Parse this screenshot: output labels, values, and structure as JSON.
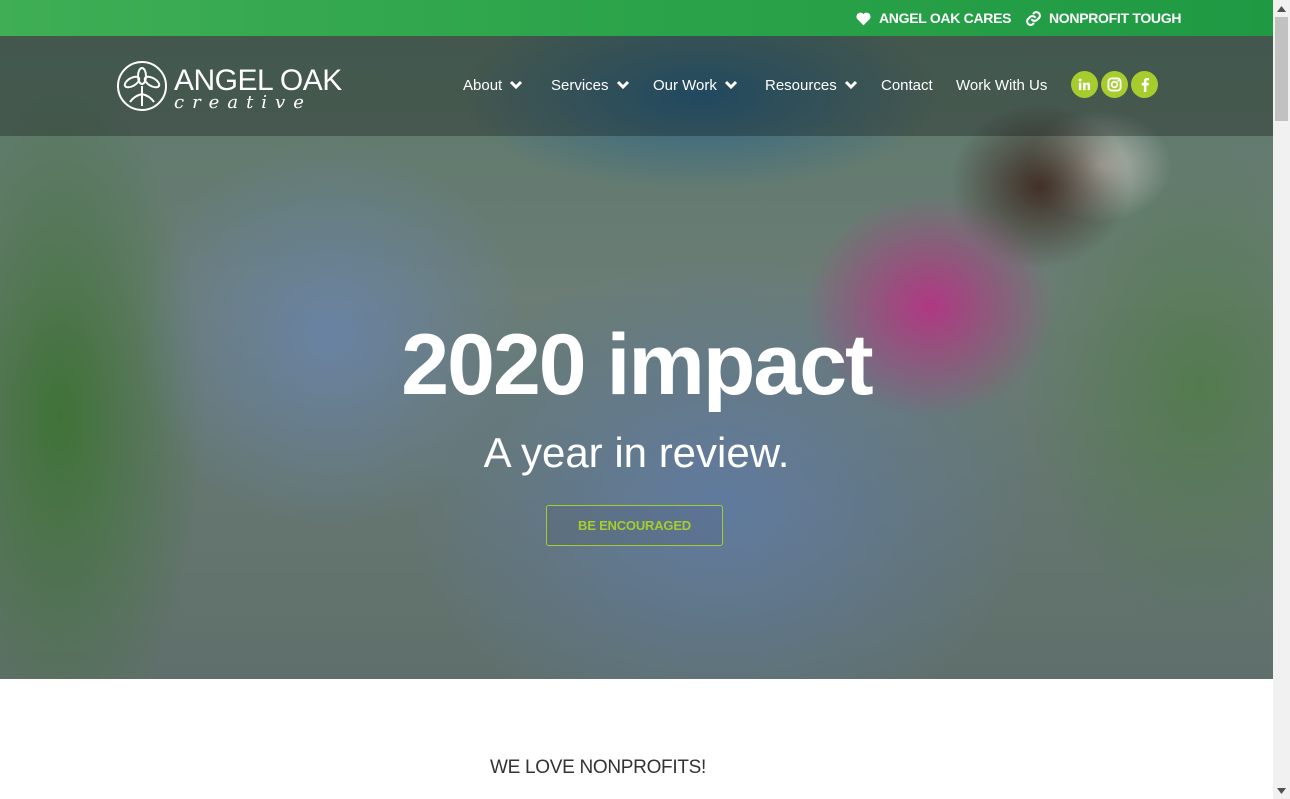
{
  "topbar": {
    "cares_label": "ANGEL OAK CARES",
    "nonprofit_label": "NONPROFIT TOUGH"
  },
  "logo": {
    "name": "ANGEL OAK",
    "sub": "creative"
  },
  "nav": {
    "items": [
      {
        "label": "About"
      },
      {
        "label": "Services"
      },
      {
        "label": "Our Work"
      },
      {
        "label": "Resources"
      },
      {
        "label": "Contact"
      },
      {
        "label": "Work With Us"
      }
    ]
  },
  "social": [
    "linkedin-icon",
    "instagram-icon",
    "facebook-icon"
  ],
  "hero": {
    "title": "2020 impact",
    "subtitle": "A year in review.",
    "cta": "BE ENCOURAGED"
  },
  "content": {
    "heading": "WE LOVE NONPROFITS!"
  },
  "colors": {
    "topbar_green": "#2ba34a",
    "accent_lime": "#a6cc2d",
    "white": "#ffffff"
  }
}
